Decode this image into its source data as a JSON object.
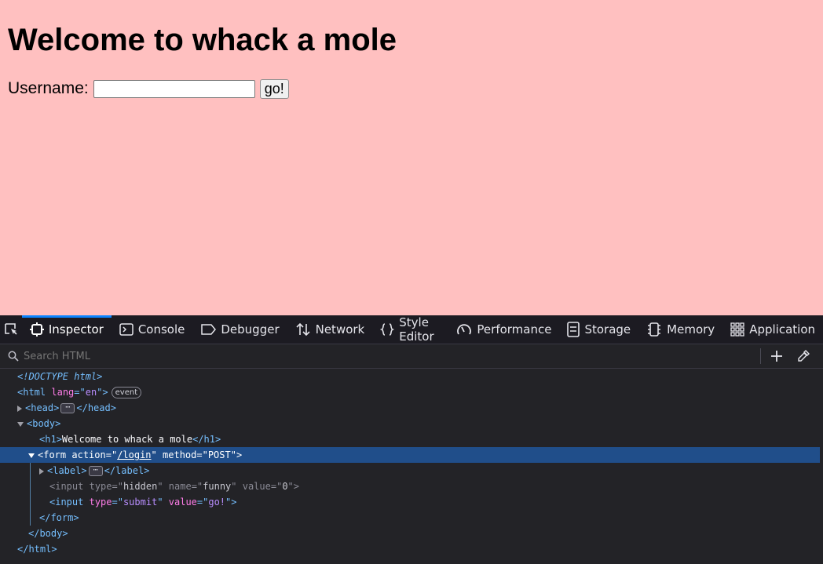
{
  "page": {
    "heading": "Welcome to whack a mole",
    "username_label": "Username:",
    "username_value": "",
    "submit_label": "go!"
  },
  "devtools": {
    "tabs": [
      {
        "label": "Inspector",
        "icon": "inspector-icon",
        "active": true
      },
      {
        "label": "Console",
        "icon": "console-icon"
      },
      {
        "label": "Debugger",
        "icon": "debugger-icon"
      },
      {
        "label": "Network",
        "icon": "network-icon"
      },
      {
        "label": "Style Editor",
        "icon": "style-editor-icon"
      },
      {
        "label": "Performance",
        "icon": "performance-icon"
      },
      {
        "label": "Storage",
        "icon": "storage-icon"
      },
      {
        "label": "Memory",
        "icon": "memory-icon"
      },
      {
        "label": "Application",
        "icon": "application-icon"
      }
    ],
    "search_placeholder": "Search HTML",
    "tree": {
      "doctype": "<!DOCTYPE html>",
      "html_open": "html",
      "html_attr": "lang",
      "html_lang": "en",
      "event_badge": "event",
      "head": "head",
      "body": "body",
      "h1_tag": "h1",
      "h1_text": "Welcome to whack a mole",
      "form_tag": "form",
      "form_attr_action": "action",
      "form_action": "/login",
      "form_attr_method": "method",
      "form_method": "POST",
      "label_tag": "label",
      "input_tag": "input",
      "attr_type": "type",
      "attr_name": "name",
      "attr_value": "value",
      "hidden_type": "hidden",
      "hidden_name": "funny",
      "hidden_value": "0",
      "submit_type": "submit",
      "submit_value": "go!",
      "ellipsis": "⋯"
    }
  },
  "colors": {
    "page_bg": "#ffc0c0",
    "devtools_bg": "#232327",
    "selection": "#204e8a",
    "accent": "#0a84ff"
  }
}
